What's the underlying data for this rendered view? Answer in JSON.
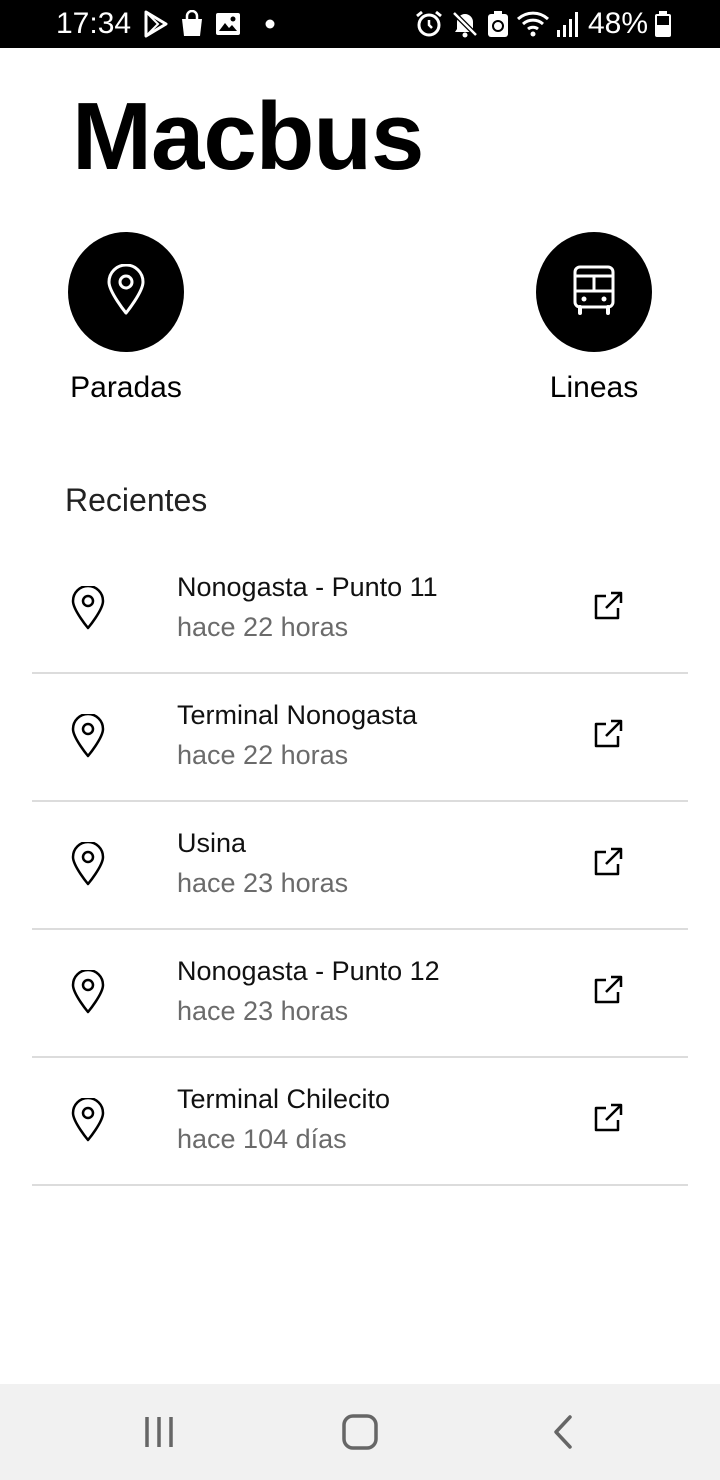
{
  "status_bar": {
    "time": "17:34",
    "battery_percent": "48%",
    "left_icons": [
      "play-store-icon",
      "shopping-bag-icon",
      "image-icon",
      "notification-dot-icon"
    ],
    "right_icons": [
      "alarm-icon",
      "mute-icon",
      "sync-icon",
      "wifi-icon",
      "signal-icon",
      "battery-icon"
    ]
  },
  "app": {
    "title": "Macbus"
  },
  "quick_actions": [
    {
      "label": "Paradas",
      "icon": "location-pin-icon"
    },
    {
      "label": "Lineas",
      "icon": "bus-icon"
    }
  ],
  "recents": {
    "title": "Recientes",
    "items": [
      {
        "name": "Nonogasta - Punto 11",
        "time": "hace 22 horas"
      },
      {
        "name": "Terminal Nonogasta",
        "time": "hace 22 horas"
      },
      {
        "name": "Usina",
        "time": "hace 23 horas"
      },
      {
        "name": "Nonogasta - Punto 12",
        "time": "hace 23 horas"
      },
      {
        "name": "Terminal Chilecito",
        "time": "hace 104 días"
      }
    ]
  },
  "nav_bar": {
    "buttons": [
      "recent-apps-icon",
      "home-icon",
      "back-icon"
    ]
  },
  "colors": {
    "accent": "#000000",
    "background": "#ffffff",
    "secondary_text": "#6b6b6b",
    "divider": "#dcdcdc",
    "nav_background": "#f1f1f1"
  }
}
